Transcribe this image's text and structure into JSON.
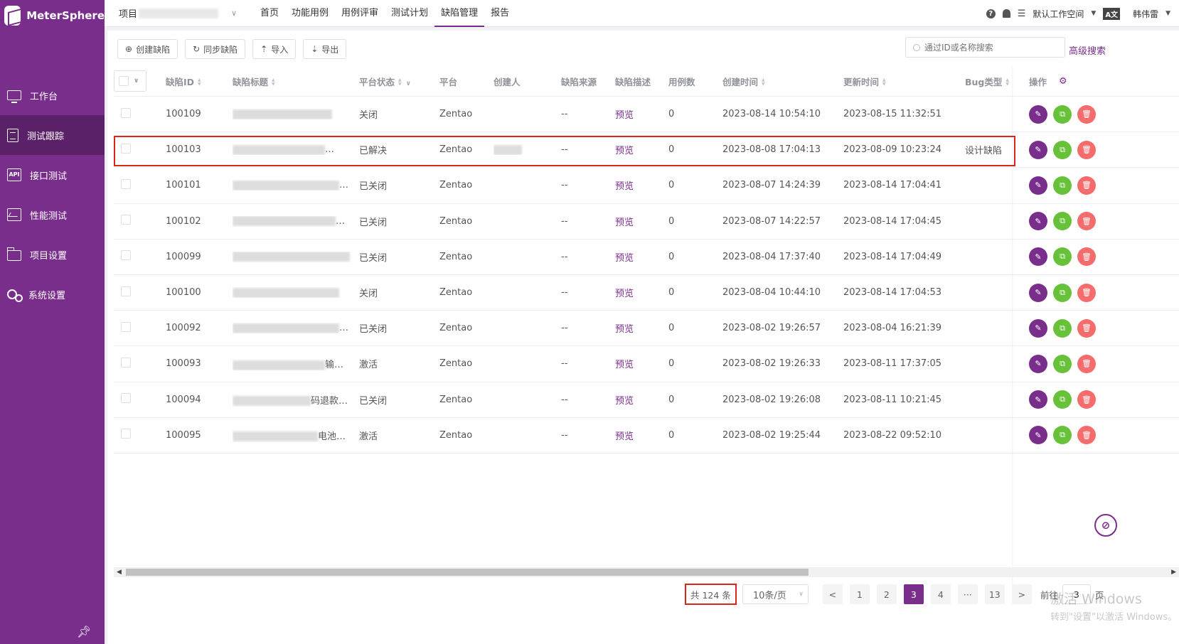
{
  "app": {
    "name": "MeterSphere"
  },
  "sidebar": {
    "items": [
      {
        "label": "工作台",
        "icon": "monitor-icon",
        "active": false
      },
      {
        "label": "测试跟踪",
        "icon": "clipboard-icon",
        "active": true
      },
      {
        "label": "接口测试",
        "icon": "api-icon",
        "active": false
      },
      {
        "label": "性能测试",
        "icon": "performance-chart-icon",
        "active": false
      },
      {
        "label": "项目设置",
        "icon": "folder-icon",
        "active": false
      },
      {
        "label": "系统设置",
        "icon": "gears-icon",
        "active": false
      }
    ],
    "pin_icon": "pin-icon"
  },
  "topbar": {
    "project_label": "项目",
    "menu": [
      {
        "label": "首页",
        "active": false
      },
      {
        "label": "功能用例",
        "active": false
      },
      {
        "label": "用例评审",
        "active": false
      },
      {
        "label": "测试计划",
        "active": false
      },
      {
        "label": "缺陷管理",
        "active": true
      },
      {
        "label": "报告",
        "active": false
      }
    ],
    "workspace": "默认工作空间",
    "user": "韩伟雷"
  },
  "toolbar": {
    "create_label": "创建缺陷",
    "sync_label": "同步缺陷",
    "import_label": "导入",
    "export_label": "导出",
    "search_placeholder": "通过ID或名称搜索",
    "advanced_search": "高级搜索"
  },
  "table": {
    "headers": {
      "id": "缺陷ID",
      "title": "缺陷标题",
      "status": "平台状态",
      "platform": "平台",
      "creator": "创建人",
      "source": "缺陷来源",
      "description": "缺陷描述",
      "case_count": "用例数",
      "created": "创建时间",
      "updated": "更新时间",
      "bug_type": "Bug类型",
      "actions": "操作"
    },
    "rows": [
      {
        "id": "100109",
        "title_suffix": "",
        "status": "关闭",
        "platform": "Zentao",
        "source": "--",
        "description": "预览",
        "count": "0",
        "created": "2023-08-14 10:54:10",
        "updated": "2023-08-15 11:32:51",
        "bug_type": ""
      },
      {
        "id": "100103",
        "title_suffix": "…",
        "status": "已解决",
        "platform": "Zentao",
        "source": "--",
        "description": "预览",
        "count": "0",
        "created": "2023-08-08 17:04:13",
        "updated": "2023-08-09 10:23:24",
        "bug_type": "设计缺陷"
      },
      {
        "id": "100101",
        "title_suffix": "…",
        "status": "已关闭",
        "platform": "Zentao",
        "source": "--",
        "description": "预览",
        "count": "0",
        "created": "2023-08-07 14:24:39",
        "updated": "2023-08-14 17:04:41",
        "bug_type": ""
      },
      {
        "id": "100102",
        "title_suffix": "…",
        "status": "已关闭",
        "platform": "Zentao",
        "source": "--",
        "description": "预览",
        "count": "0",
        "created": "2023-08-07 14:22:57",
        "updated": "2023-08-14 17:04:45",
        "bug_type": ""
      },
      {
        "id": "100099",
        "title_suffix": "",
        "status": "已关闭",
        "platform": "Zentao",
        "source": "--",
        "description": "预览",
        "count": "0",
        "created": "2023-08-04 17:37:40",
        "updated": "2023-08-14 17:04:49",
        "bug_type": ""
      },
      {
        "id": "100100",
        "title_suffix": "",
        "status": "关闭",
        "platform": "Zentao",
        "source": "--",
        "description": "预览",
        "count": "0",
        "created": "2023-08-04 10:44:10",
        "updated": "2023-08-14 17:04:53",
        "bug_type": ""
      },
      {
        "id": "100092",
        "title_suffix": "…",
        "status": "已关闭",
        "platform": "Zentao",
        "source": "--",
        "description": "预览",
        "count": "0",
        "created": "2023-08-02 19:26:57",
        "updated": "2023-08-04 16:21:39",
        "bug_type": ""
      },
      {
        "id": "100093",
        "title_suffix": "输…",
        "status": "激活",
        "platform": "Zentao",
        "source": "--",
        "description": "预览",
        "count": "0",
        "created": "2023-08-02 19:26:33",
        "updated": "2023-08-11 17:37:05",
        "bug_type": ""
      },
      {
        "id": "100094",
        "title_suffix": "码退款…",
        "status": "已关闭",
        "platform": "Zentao",
        "source": "--",
        "description": "预览",
        "count": "0",
        "created": "2023-08-02 19:26:08",
        "updated": "2023-08-11 10:21:45",
        "bug_type": ""
      },
      {
        "id": "100095",
        "title_suffix": "电池…",
        "status": "激活",
        "platform": "Zentao",
        "source": "--",
        "description": "预览",
        "count": "0",
        "created": "2023-08-02 19:25:44",
        "updated": "2023-08-22 09:52:10",
        "bug_type": ""
      }
    ]
  },
  "pagination": {
    "total": "共 124 条",
    "page_size": "10条/页",
    "pages": [
      "1",
      "2",
      "3",
      "4",
      "···",
      "13"
    ],
    "current": "3",
    "prev": "<",
    "next": ">",
    "goto_label": "前往",
    "goto_value": "3",
    "page_unit": "页"
  },
  "watermark": {
    "line1": "激活 Windows",
    "line2": "转到\"设置\"以激活 Windows。"
  },
  "colors": {
    "brand": "#7a2e8c",
    "edit": "#7a2e8c",
    "copy": "#67c23a",
    "delete": "#f56c6c",
    "highlight": "#d9261c"
  }
}
